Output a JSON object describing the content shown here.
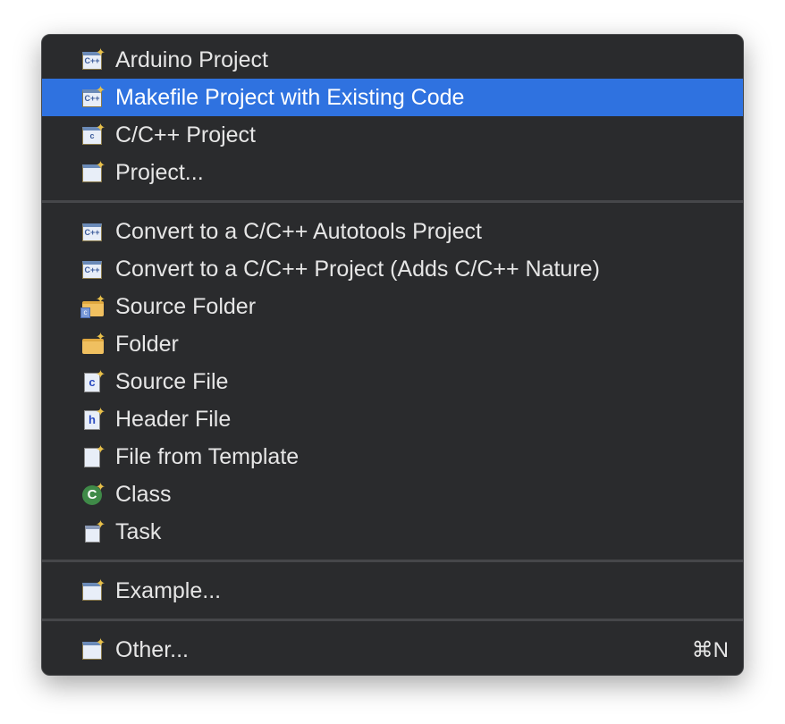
{
  "menu": {
    "group1": [
      {
        "label": "Arduino Project",
        "icon": "cpp-project-icon"
      },
      {
        "label": "Makefile Project with Existing Code",
        "icon": "cpp-project-icon"
      },
      {
        "label": "C/C++ Project",
        "icon": "c-project-icon"
      },
      {
        "label": "Project...",
        "icon": "new-project-icon"
      }
    ],
    "group2": [
      {
        "label": "Convert to a C/C++ Autotools Project",
        "icon": "cpp-convert-icon"
      },
      {
        "label": "Convert to a C/C++ Project (Adds C/C++ Nature)",
        "icon": "cpp-convert-icon"
      },
      {
        "label": "Source Folder",
        "icon": "source-folder-icon"
      },
      {
        "label": "Folder",
        "icon": "folder-icon"
      },
      {
        "label": "Source File",
        "icon": "source-file-icon"
      },
      {
        "label": "Header File",
        "icon": "header-file-icon"
      },
      {
        "label": "File from Template",
        "icon": "file-icon"
      },
      {
        "label": "Class",
        "icon": "class-icon"
      },
      {
        "label": "Task",
        "icon": "task-icon"
      }
    ],
    "group3": [
      {
        "label": "Example...",
        "icon": "new-project-icon"
      }
    ],
    "group4": [
      {
        "label": "Other...",
        "icon": "new-project-icon",
        "shortcut": "⌘N"
      }
    ],
    "icon_text": {
      "cpp": "C++",
      "c": "c",
      "h": "h",
      "cls": "C"
    },
    "highlight_color": "#2f72e0"
  }
}
